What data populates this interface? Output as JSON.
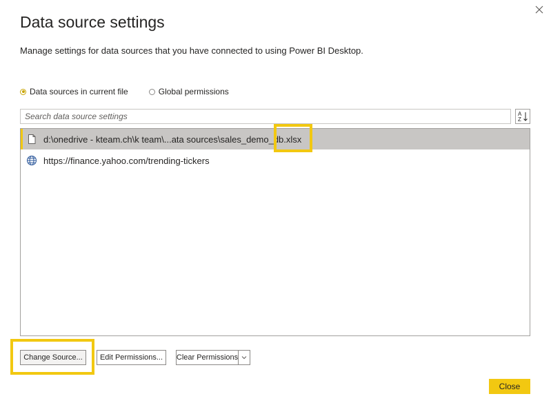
{
  "dialog": {
    "title": "Data source settings",
    "subtitle": "Manage settings for data sources that you have connected to using Power BI Desktop."
  },
  "scope": {
    "options": [
      {
        "label": "Data sources in current file",
        "selected": true
      },
      {
        "label": "Global permissions",
        "selected": false
      }
    ]
  },
  "search": {
    "placeholder": "Search data source settings",
    "value": ""
  },
  "sources": [
    {
      "label": "d:\\onedrive - kteam.ch\\k team\\...ata sources\\sales_demo_db.xlsx",
      "icon": "file-icon",
      "selected": true
    },
    {
      "label": "https://finance.yahoo.com/trending-tickers",
      "icon": "globe-icon",
      "selected": false
    }
  ],
  "buttons": {
    "change_source": "Change Source...",
    "edit_permissions": "Edit Permissions...",
    "clear_permissions": "Clear Permissions",
    "close": "Close"
  },
  "icons": {
    "close": "close-icon",
    "sort": "sort-az-icon",
    "dropdown": "chevron-down-icon"
  },
  "colors": {
    "accent": "#f2c811",
    "selected_row": "#c8c6c4",
    "radio_checked": "#c8a400"
  }
}
